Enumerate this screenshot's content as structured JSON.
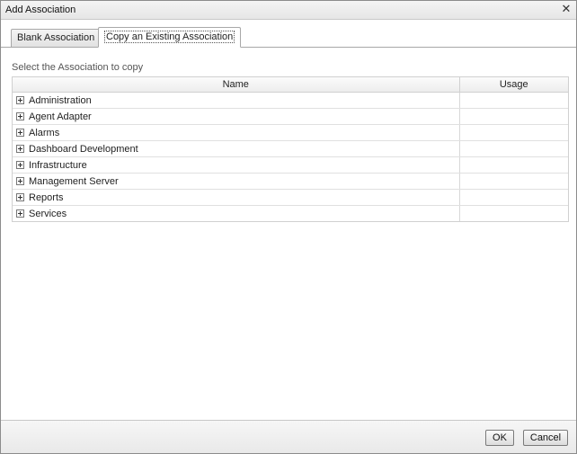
{
  "dialog": {
    "title": "Add Association",
    "close_glyph": "✕"
  },
  "tabs": [
    {
      "label": "Blank Association",
      "active": false
    },
    {
      "label": "Copy an Existing Association",
      "active": true
    }
  ],
  "instructions": "Select the Association to copy",
  "grid": {
    "columns": [
      "Name",
      "Usage"
    ],
    "rows": [
      {
        "name": "Administration",
        "usage": ""
      },
      {
        "name": "Agent Adapter",
        "usage": ""
      },
      {
        "name": "Alarms",
        "usage": ""
      },
      {
        "name": "Dashboard Development",
        "usage": ""
      },
      {
        "name": "Infrastructure",
        "usage": ""
      },
      {
        "name": "Management Server",
        "usage": ""
      },
      {
        "name": "Reports",
        "usage": ""
      },
      {
        "name": "Services",
        "usage": ""
      }
    ]
  },
  "buttons": {
    "ok": "OK",
    "cancel": "Cancel"
  }
}
